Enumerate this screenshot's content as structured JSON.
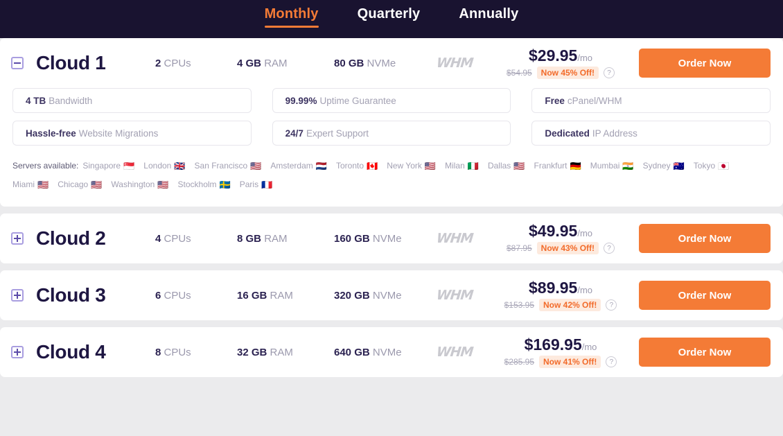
{
  "tabs": [
    {
      "label": "Monthly",
      "active": true
    },
    {
      "label": "Quarterly",
      "active": false
    },
    {
      "label": "Annually",
      "active": false
    }
  ],
  "colors": {
    "accent": "#f47b36",
    "header_bg": "#191330",
    "heading": "#1e1642",
    "muted": "#9b99ad",
    "discount_bg": "#fdeade",
    "toggle_border": "#a99ee0"
  },
  "order_label": "Order Now",
  "help_glyph": "?",
  "whm_label": "WHM",
  "servers_label": "Servers available:",
  "servers": [
    {
      "city": "Singapore",
      "flag": "🇸🇬"
    },
    {
      "city": "London",
      "flag": "🇬🇧"
    },
    {
      "city": "San Francisco",
      "flag": "🇺🇸"
    },
    {
      "city": "Amsterdam",
      "flag": "🇳🇱"
    },
    {
      "city": "Toronto",
      "flag": "🇨🇦"
    },
    {
      "city": "New York",
      "flag": "🇺🇸"
    },
    {
      "city": "Milan",
      "flag": "🇮🇹"
    },
    {
      "city": "Dallas",
      "flag": "🇺🇸"
    },
    {
      "city": "Frankfurt",
      "flag": "🇩🇪"
    },
    {
      "city": "Mumbai",
      "flag": "🇮🇳"
    },
    {
      "city": "Sydney",
      "flag": "🇦🇺"
    },
    {
      "city": "Tokyo",
      "flag": "🇯🇵"
    },
    {
      "city": "Miami",
      "flag": "🇺🇸"
    },
    {
      "city": "Chicago",
      "flag": "🇺🇸"
    },
    {
      "city": "Washington",
      "flag": "🇺🇸"
    },
    {
      "city": "Stockholm",
      "flag": "🇸🇪"
    },
    {
      "city": "Paris",
      "flag": "🇫🇷"
    }
  ],
  "plans": [
    {
      "name": "Cloud 1",
      "expanded": true,
      "toggle_state": "minus",
      "cpu_value": "2",
      "cpu_unit": "CPUs",
      "ram_value": "4 GB",
      "ram_unit": "RAM",
      "disk_value": "80 GB",
      "disk_unit": "NVMe",
      "price": "$29.95",
      "period": "/mo",
      "old_price": "$54.95",
      "discount": "Now 45% Off!",
      "features": [
        {
          "strong": "4 TB",
          "rest": "Bandwidth"
        },
        {
          "strong": "99.99%",
          "rest": "Uptime Guarantee"
        },
        {
          "strong": "Free",
          "rest": "cPanel/WHM"
        },
        {
          "strong": "Hassle-free",
          "rest": "Website Migrations"
        },
        {
          "strong": "24/7",
          "rest": "Expert Support"
        },
        {
          "strong": "Dedicated",
          "rest": "IP Address"
        }
      ]
    },
    {
      "name": "Cloud 2",
      "expanded": false,
      "toggle_state": "plus",
      "cpu_value": "4",
      "cpu_unit": "CPUs",
      "ram_value": "8 GB",
      "ram_unit": "RAM",
      "disk_value": "160 GB",
      "disk_unit": "NVMe",
      "price": "$49.95",
      "period": "/mo",
      "old_price": "$87.95",
      "discount": "Now 43% Off!",
      "features": []
    },
    {
      "name": "Cloud 3",
      "expanded": false,
      "toggle_state": "plus",
      "cpu_value": "6",
      "cpu_unit": "CPUs",
      "ram_value": "16 GB",
      "ram_unit": "RAM",
      "disk_value": "320 GB",
      "disk_unit": "NVMe",
      "price": "$89.95",
      "period": "/mo",
      "old_price": "$153.95",
      "discount": "Now 42% Off!",
      "features": []
    },
    {
      "name": "Cloud 4",
      "expanded": false,
      "toggle_state": "plus",
      "cpu_value": "8",
      "cpu_unit": "CPUs",
      "ram_value": "32 GB",
      "ram_unit": "RAM",
      "disk_value": "640 GB",
      "disk_unit": "NVMe",
      "price": "$169.95",
      "period": "/mo",
      "old_price": "$285.95",
      "discount": "Now 41% Off!",
      "features": []
    }
  ]
}
